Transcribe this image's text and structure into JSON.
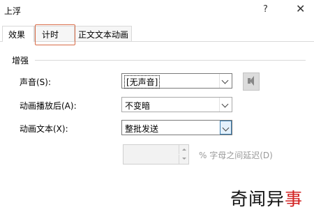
{
  "window": {
    "title": "上浮",
    "help": "?",
    "close": "✕"
  },
  "tabs": [
    {
      "label": "效果",
      "selected": true
    },
    {
      "label": "计时",
      "selected": false
    },
    {
      "label": "正文文本动画",
      "selected": false
    }
  ],
  "enhancements": {
    "group_title": "增强",
    "sound": {
      "label": "声音(S):",
      "value": "[无声音]"
    },
    "after_animation": {
      "label": "动画播放后(A):",
      "value": "不变暗"
    },
    "animate_text": {
      "label": "动画文本(X):",
      "value": "整批发送"
    },
    "delay": {
      "value": "",
      "label": "% 字母之间延迟(D)"
    }
  },
  "watermark": {
    "text1": "奇闻异",
    "text2": "事"
  },
  "colors": {
    "tab_highlight": "#d76a45",
    "watermark_red": "#d22020"
  }
}
